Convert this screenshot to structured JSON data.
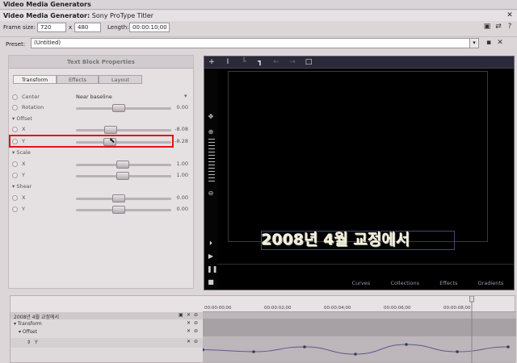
{
  "window": {
    "title": "Video Media Generators",
    "subtitle_label": "Video Media Generator:",
    "subtitle_value": "Sony ProType Titler",
    "close_glyph": "✕"
  },
  "frame": {
    "size_label": "Frame size:",
    "width": "720",
    "x_label": "x",
    "height": "480",
    "length_label": "Length:",
    "length": "00:00:10;00"
  },
  "preset": {
    "label": "Preset:",
    "value": "(Untitled)"
  },
  "panel": {
    "title": "Text Block Properties",
    "tabs": [
      {
        "label": "Transform",
        "active": true
      },
      {
        "label": "Effects",
        "active": false
      },
      {
        "label": "Layout",
        "active": false
      }
    ],
    "rows": {
      "center": {
        "label": "Center",
        "value": "Near baseline"
      },
      "rotation": {
        "label": "Rotation",
        "value": "0.00"
      },
      "offset_group": "Offset",
      "offset_x": {
        "label": "X",
        "value": "-8.08"
      },
      "offset_y": {
        "label": "Y",
        "value": "-8.28"
      },
      "scale_group": "Scale",
      "scale_x": {
        "label": "X",
        "value": "1.00"
      },
      "scale_y": {
        "label": "Y",
        "value": "1.00"
      },
      "shear_group": "Shear",
      "shear_x": {
        "label": "X",
        "value": "0.00"
      },
      "shear_y": {
        "label": "Y",
        "value": "0.00"
      }
    }
  },
  "preview": {
    "canvas_text": "2008년 4월 교정에서",
    "tabs": [
      "Curves",
      "Collections",
      "Effects",
      "Gradients"
    ]
  },
  "timeline": {
    "ticks": [
      "00:00:00;00",
      "00:00:02;00",
      "00:00:04;00",
      "00:00:06;00",
      "00:00:08;00"
    ],
    "tracks": [
      "2008년 4월 교정에서",
      "Transform",
      "Offset",
      "Y"
    ],
    "keyframe_curve": [
      -8.28,
      -8.2,
      -8.4,
      -8.1,
      -8.5,
      -8.2,
      -8.4
    ]
  },
  "colors": {
    "highlight": "#e11414",
    "preview_bg": "#000000",
    "accent_text": "#f4f0e0"
  }
}
